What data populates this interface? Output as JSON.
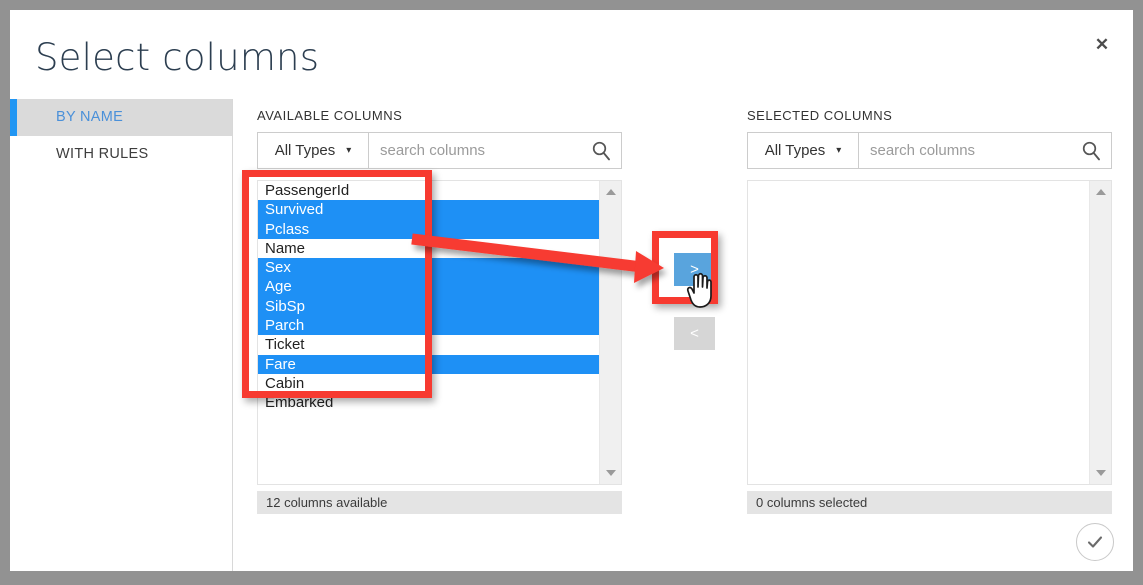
{
  "window": {
    "title": "Select columns",
    "close_label": "✕"
  },
  "sidebar": {
    "items": [
      {
        "label": "BY NAME",
        "active": true
      },
      {
        "label": "WITH RULES",
        "active": false
      }
    ]
  },
  "available_panel": {
    "heading": "AVAILABLE COLUMNS",
    "type_filter": {
      "value": "All Types",
      "caret": "▾"
    },
    "search": {
      "value": "",
      "placeholder": "search columns"
    },
    "status": "12 columns available",
    "items": [
      {
        "label": "PassengerId",
        "selected": false
      },
      {
        "label": "Survived",
        "selected": true
      },
      {
        "label": "Pclass",
        "selected": true
      },
      {
        "label": "Name",
        "selected": false
      },
      {
        "label": "Sex",
        "selected": true
      },
      {
        "label": "Age",
        "selected": true
      },
      {
        "label": "SibSp",
        "selected": true
      },
      {
        "label": "Parch",
        "selected": true
      },
      {
        "label": "Ticket",
        "selected": false
      },
      {
        "label": "Fare",
        "selected": true
      },
      {
        "label": "Cabin",
        "selected": false
      },
      {
        "label": "Embarked",
        "selected": false
      }
    ]
  },
  "selected_panel": {
    "heading": "SELECTED COLUMNS",
    "type_filter": {
      "value": "All Types",
      "caret": "▾"
    },
    "search": {
      "value": "",
      "placeholder": "search columns"
    },
    "status": "0 columns selected",
    "items": []
  },
  "transfer": {
    "add_label": ">",
    "remove_label": "<"
  },
  "confirm": {
    "icon": "checkmark-icon"
  },
  "colors": {
    "accent_blue": "#1e90f5",
    "button_blue": "#59a4dd",
    "annotation_red": "#f73a30",
    "sidebar_active_bg": "#dadada",
    "status_bar_bg": "#e4e4e4",
    "window_chrome": "#929292"
  }
}
